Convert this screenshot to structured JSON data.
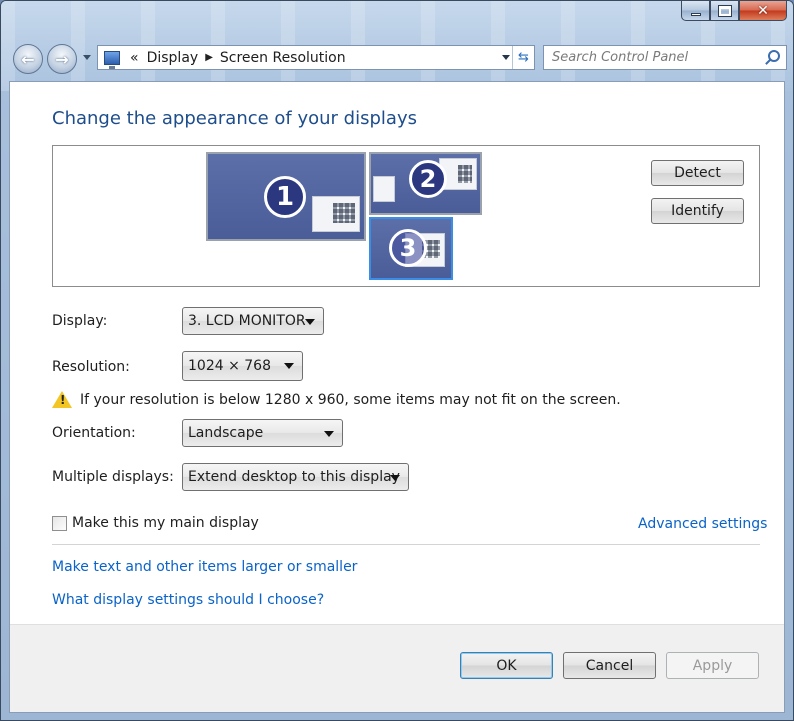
{
  "window": {
    "caption_buttons": [
      "minimize",
      "maximize",
      "close"
    ],
    "close_glyph": "✕"
  },
  "navbar": {
    "back_glyph": "←",
    "forward_glyph": "→",
    "overflow_glyph": "«",
    "breadcrumbs": [
      "Display",
      "Screen Resolution"
    ],
    "crumb_sep_glyph": "▶",
    "refresh_glyph": "⇆",
    "search_placeholder": "Search Control Panel"
  },
  "main": {
    "title": "Change the appearance of your displays",
    "monitors": [
      {
        "number": "1",
        "selected": false
      },
      {
        "number": "2",
        "selected": false
      },
      {
        "number": "3",
        "selected": true
      }
    ],
    "detect_label": "Detect",
    "identify_label": "Identify",
    "display": {
      "label": "Display:",
      "value": "3. LCD MONITOR"
    },
    "resolution": {
      "label": "Resolution:",
      "value": "1024 × 768"
    },
    "warning_text": "If your resolution is below 1280 x 960, some items may not fit on the screen.",
    "orientation": {
      "label": "Orientation:",
      "value": "Landscape"
    },
    "multiple_displays": {
      "label": "Multiple displays:",
      "value": "Extend desktop to this display"
    },
    "main_display_checkbox": {
      "label": "Make this my main display",
      "checked": false
    },
    "advanced_settings_link": "Advanced settings",
    "text_size_link": "Make text and other items larger or smaller",
    "help_link": "What display settings should I choose?"
  },
  "footer": {
    "ok_label": "OK",
    "cancel_label": "Cancel",
    "apply_label": "Apply"
  },
  "colors": {
    "title_blue": "#1e4d8c",
    "link_blue": "#0a63c9",
    "selection_border": "#3b8ee6"
  }
}
